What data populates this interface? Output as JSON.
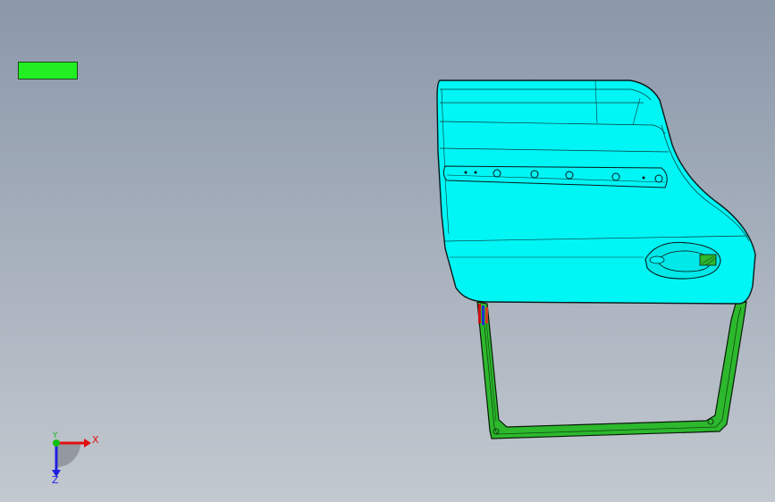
{
  "colors": {
    "background_top": "#8b98aa",
    "background_bottom": "#c2c8cf",
    "indicator": "#22ee22",
    "panel_surface": "#00f5f5",
    "frame": "#2db82d",
    "edge": "#0a1a1a",
    "axis_x": "#e01010",
    "axis_y": "#10c010",
    "axis_z": "#2020e0"
  },
  "triad": {
    "x_label": "X",
    "y_label": "Y",
    "z_label": "Z"
  }
}
